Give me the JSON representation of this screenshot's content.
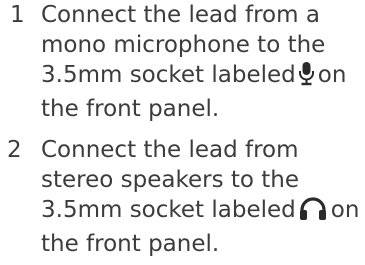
{
  "steps": [
    {
      "number": "1",
      "lines": [
        "Connect the lead from a",
        "mono microphone to the",
        "3.5mm socket labeled",
        "on",
        "the front panel."
      ],
      "icon": "microphone-icon"
    },
    {
      "number": "2",
      "lines": [
        "Connect the lead from",
        "stereo speakers to the",
        "3.5mm socket labeled",
        "on",
        "the front panel."
      ],
      "icon": "headphones-icon"
    }
  ],
  "colors": {
    "text": "#3c3c3c",
    "icon": "#2a2a2a"
  }
}
